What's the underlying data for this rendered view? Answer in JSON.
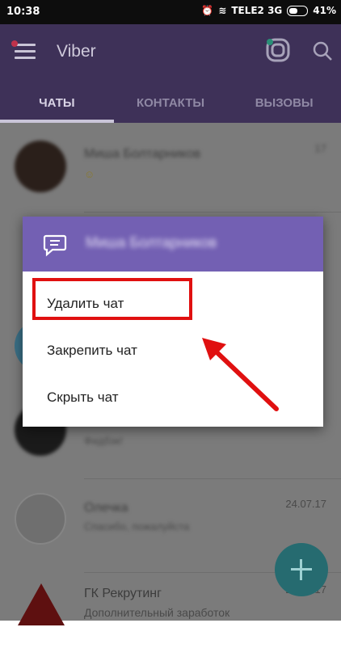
{
  "status_bar": {
    "time": "10:38",
    "carrier": "TELE2 3G",
    "battery": "41%"
  },
  "app": {
    "title": "Viber"
  },
  "tabs": [
    {
      "label": "ЧАТЫ",
      "active": true
    },
    {
      "label": "КОНТАКТЫ",
      "active": false
    },
    {
      "label": "ВЫЗОВЫ",
      "active": false
    }
  ],
  "chats": [
    {
      "name": "Миша Болтарников",
      "message": "",
      "time": "17"
    },
    {
      "name": "",
      "message": "",
      "time": ""
    },
    {
      "name": "",
      "message": "",
      "time": ""
    },
    {
      "name": "",
      "message": "Фидбэк!",
      "time": ""
    },
    {
      "name": "Олечка",
      "message": "Спасибо, пожалуйста",
      "time": "24.07.17"
    },
    {
      "name": "ГК Рекрутинг",
      "message": "Дополнительный заработок",
      "time": "20.07.17"
    }
  ],
  "dialog": {
    "contact": "Миша Болтарников",
    "items": [
      "Удалить чат",
      "Закрепить чат",
      "Скрыть чат"
    ]
  },
  "colors": {
    "appbar": "#3e3158",
    "dialog_header": "#7360b3",
    "highlight": "#e01010",
    "fab": "#266b70"
  }
}
